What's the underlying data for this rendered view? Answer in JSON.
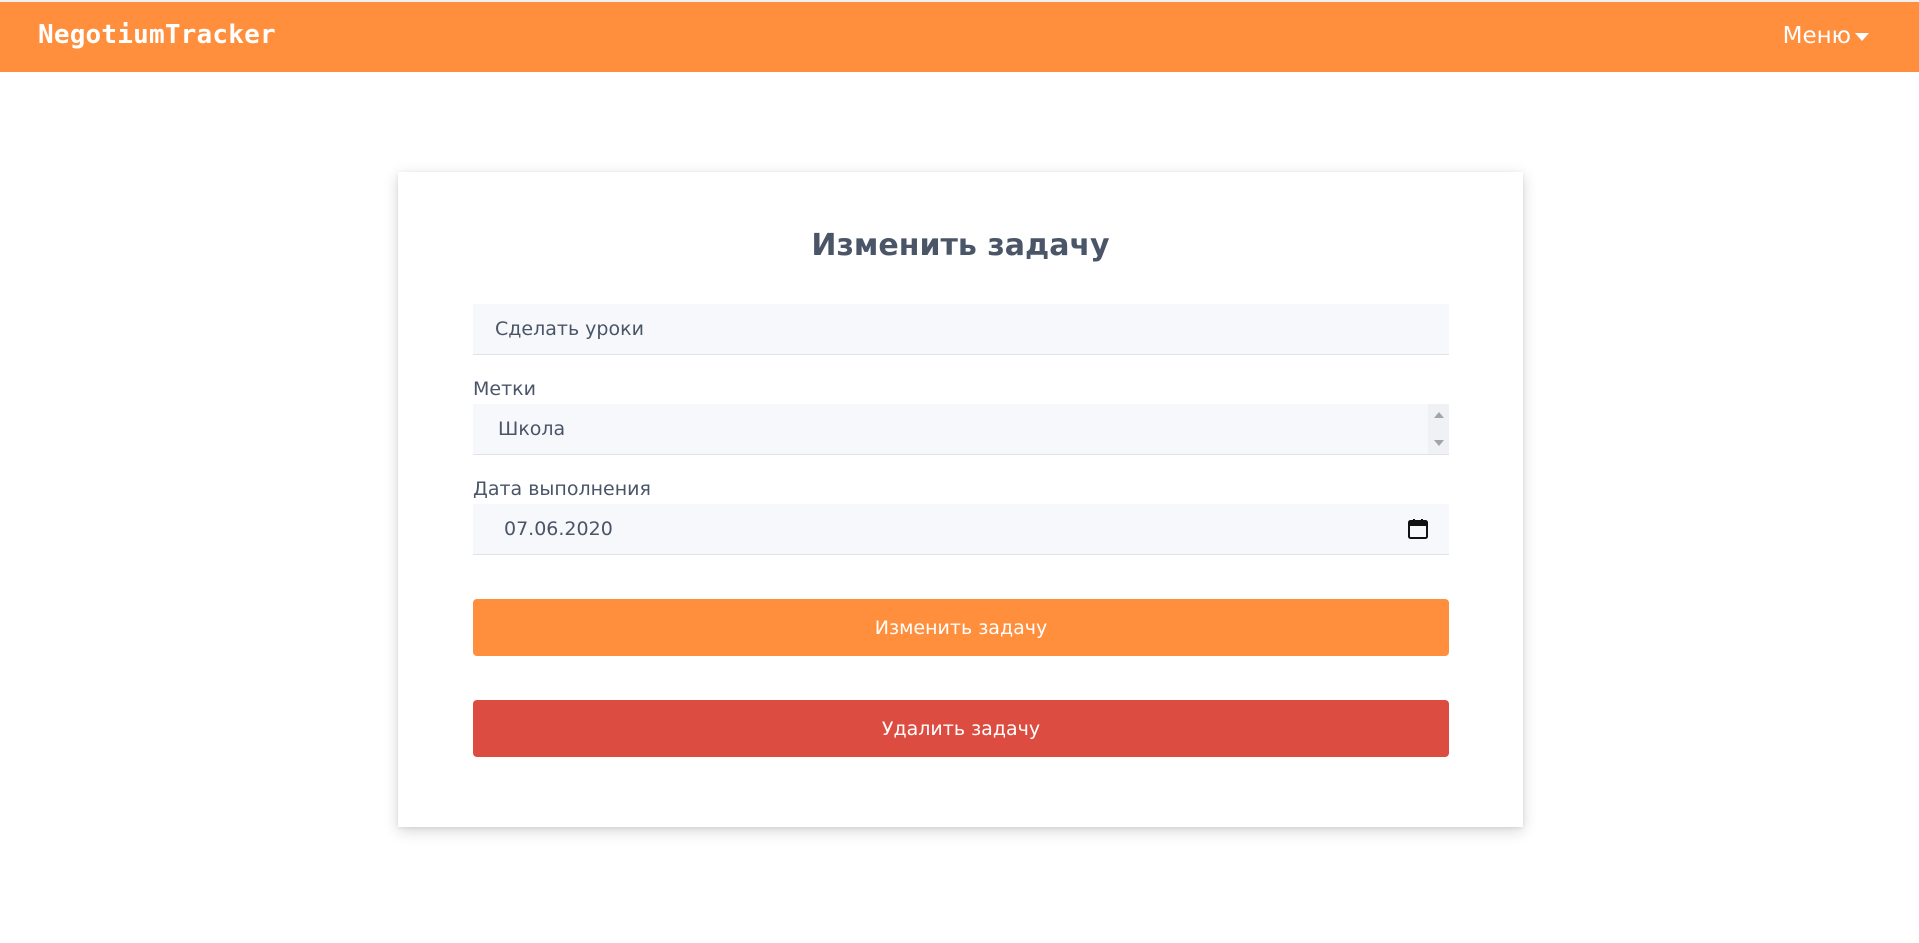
{
  "navbar": {
    "brand": "NegotiumTracker",
    "menu_label": "Меню",
    "background_color": "#ff8f3d"
  },
  "form": {
    "title": "Изменить задачу",
    "task_name_value": "Сделать уроки",
    "tags_label": "Метки",
    "tags_selected": "Школа",
    "due_date_label": "Дата выполнения",
    "due_date_value": "07.06.2020",
    "submit_label": "Изменить задачу",
    "delete_label": "Удалить задачу"
  },
  "colors": {
    "accent": "#ff8f3d",
    "danger": "#dd4c40",
    "text": "#4a5568",
    "input_bg": "#f7f8fb"
  }
}
